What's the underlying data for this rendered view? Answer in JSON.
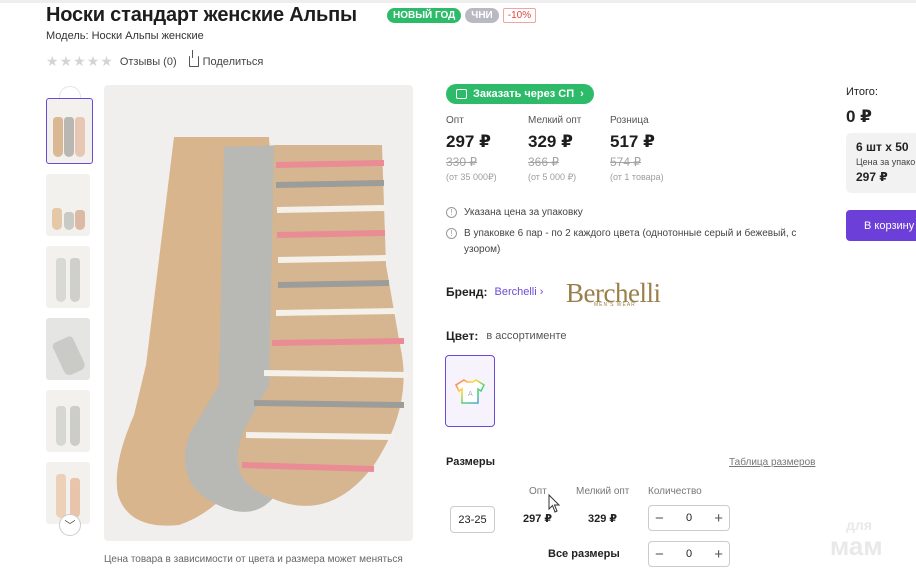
{
  "header": {
    "title": "Носки стандарт женские Альпы",
    "badges": [
      "НОВЫЙ ГОД",
      "ЧНИ",
      "-10%"
    ],
    "model": "Модель: Носки Альпы женские",
    "reviews": "Отзывы (0)",
    "share": "Поделиться"
  },
  "gallery": {
    "caption": "Цена товара в зависимости от цвета и размера может меняться"
  },
  "order_sp": "Заказать через СП",
  "prices": [
    {
      "label": "Опт",
      "price": "297 ₽",
      "old": "330 ₽",
      "note": "(от 35 000₽)"
    },
    {
      "label": "Мелкий опт",
      "price": "329 ₽",
      "old": "366 ₽",
      "note": "(от 5 000 ₽)"
    },
    {
      "label": "Розница",
      "price": "517 ₽",
      "old": "574 ₽",
      "note": "(от 1 товара)"
    }
  ],
  "info": [
    "Указана цена за упаковку",
    "В упаковке 6 пар - по 2 каждого цвета (однотонные серый и бежевый, с узором)"
  ],
  "brand": {
    "label": "Бренд:",
    "link": "Berchelli",
    "logo": "Berchelli",
    "logo_sub": "MEN'S WEAR"
  },
  "color": {
    "label": "Цвет:",
    "value": "в ассортименте"
  },
  "sizes": {
    "title": "Размеры",
    "table_link": "Таблица размеров",
    "headers": [
      "Опт",
      "Мелкий опт",
      "Количество"
    ],
    "row": {
      "size": "23-25",
      "opt": "297 ₽",
      "small_opt": "329 ₽",
      "qty": "0"
    },
    "all_label": "Все размеры",
    "all_qty": "0"
  },
  "summary": {
    "total_label": "Итого:",
    "total_value": "0 ₽",
    "pack_title": "6 шт х 50",
    "pack_sub": "Цена за упако",
    "pack_price": "297 ₽",
    "cart_button": "В корзину"
  },
  "watermark": {
    "top": "для",
    "bottom": "мам"
  },
  "colors": {
    "accent": "#6b3fd8",
    "green": "#2dbb6a",
    "sale": "#e4443b"
  }
}
